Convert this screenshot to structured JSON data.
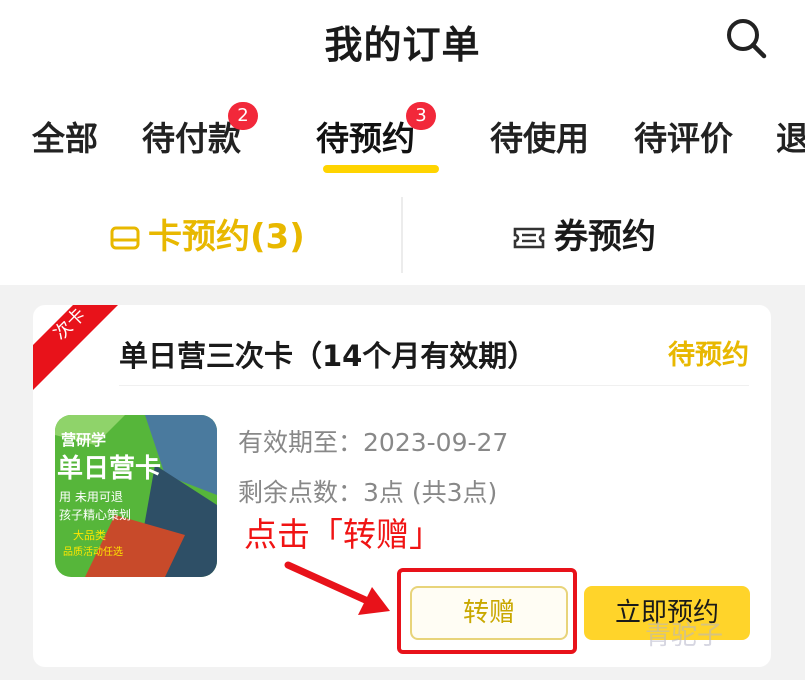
{
  "header": {
    "title": "我的订单",
    "search_icon": "search-icon"
  },
  "tabs": [
    {
      "label": "全部",
      "badge": ""
    },
    {
      "label": "待付款",
      "badge": "2"
    },
    {
      "label": "待预约",
      "badge": "3",
      "active": true
    },
    {
      "label": "待使用",
      "badge": ""
    },
    {
      "label": "待评价",
      "badge": ""
    },
    {
      "label": "退",
      "badge": ""
    }
  ],
  "subtabs": [
    {
      "label": "卡预约(3)",
      "icon": "card-icon",
      "active": true
    },
    {
      "label": "券预约",
      "icon": "ticket-icon",
      "active": false
    }
  ],
  "order": {
    "ribbon": "次卡",
    "title": "单日营三次卡（14个月有效期）",
    "status": "待预约",
    "thumbnail": {
      "line1": "营研学",
      "line2": "单日营卡",
      "line3": "用 未用可退",
      "line4": "孩子精心策划",
      "line5": "大品类",
      "line6": "品质活动任选"
    },
    "validity_label": "有效期至：",
    "validity_value": "2023-09-27",
    "points_label": "剩余点数：",
    "points_value": "3点 (共3点)",
    "gift_button": "转赠",
    "reserve_button": "立即预约"
  },
  "annotation": "点击「转赠」",
  "watermark": "青驼子",
  "colors": {
    "accent_yellow": "#ffd400",
    "status_yellow": "#e8b800",
    "badge_red": "#f2283a",
    "annotation_red": "#f01414"
  }
}
